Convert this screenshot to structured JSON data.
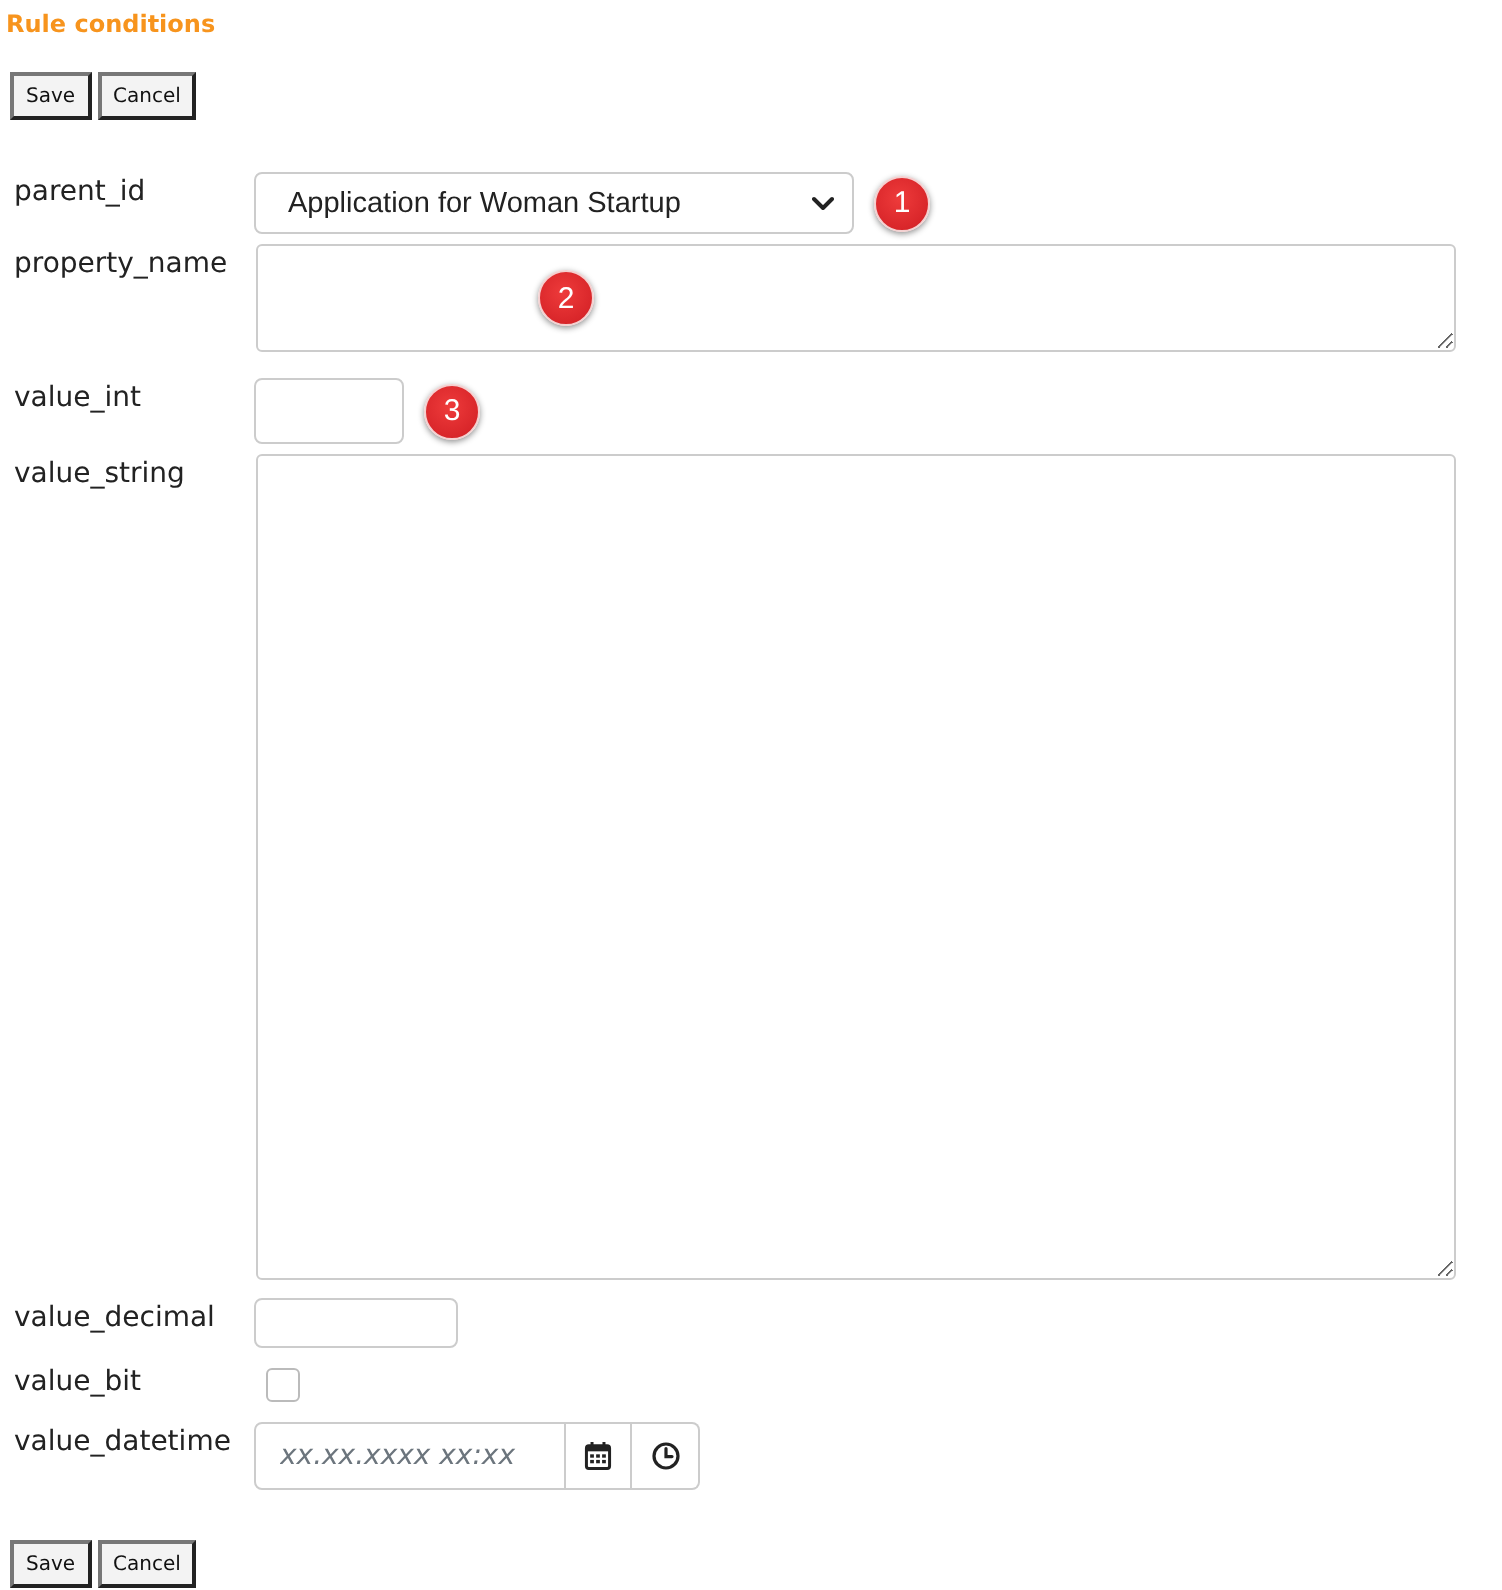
{
  "title": "Rule conditions",
  "top_buttons": [
    "Save",
    "Cancel"
  ],
  "fields": [
    {
      "label": "parent_id",
      "kind": "select",
      "value": "Application for Woman Startup",
      "marker": "1"
    },
    {
      "label": "property_name",
      "kind": "short_text",
      "marker": "2"
    },
    {
      "label": "value_int",
      "kind": "int",
      "marker": "3"
    },
    {
      "label": "value_string",
      "kind": "long_text"
    },
    {
      "label": "value_decimal",
      "kind": "decimal"
    },
    {
      "label": "value_bit",
      "kind": "checkbox",
      "checked": false
    },
    {
      "label": "value_datetime",
      "kind": "datetime",
      "placeholder": "xx.xx.xxxx xx:xx"
    }
  ],
  "bottom_buttons": [
    "Save",
    "Cancel"
  ]
}
